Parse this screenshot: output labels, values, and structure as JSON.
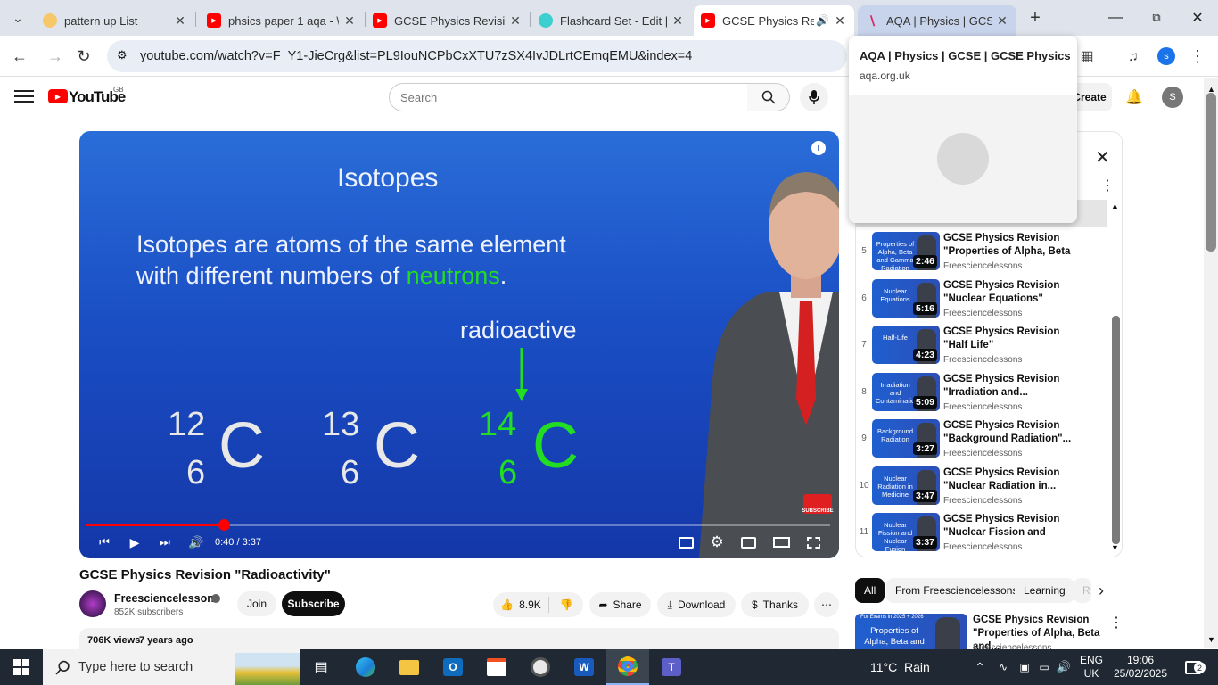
{
  "browser": {
    "tabs": [
      {
        "title": "pattern up List",
        "favicon": "lightbulb-icon"
      },
      {
        "title": "phsics paper 1 aqa - \\",
        "favicon": "youtube-icon"
      },
      {
        "title": "GCSE Physics Revisio",
        "favicon": "youtube-icon"
      },
      {
        "title": "Flashcard Set - Edit | ",
        "favicon": "quizlet-icon"
      },
      {
        "title": "GCSE Physics Rev",
        "favicon": "youtube-icon"
      },
      {
        "title": "AQA | Physics | GCSE",
        "favicon": "aqa-icon"
      }
    ],
    "url": "youtube.com/watch?v=F_Y1-JieCrg&list=PL9IouNCPbCxXTU7zSX4IvJDLrtCEmqEMU&index=4",
    "profile_initial": "s"
  },
  "hover_card": {
    "title": "AQA | Physics | GCSE | GCSE Physics",
    "domain": "aqa.org.uk"
  },
  "youtube": {
    "logo_text": "YouTube",
    "region": "GB",
    "search_placeholder": "Search",
    "create_label": "Create",
    "avatar_initial": "S"
  },
  "video": {
    "slide": {
      "heading": "Isotopes",
      "line1": "Isotopes are atoms of the same element",
      "line2_prefix": "with different numbers of ",
      "line2_highlight": "neutrons",
      "line2_suffix": ".",
      "label": "radioactive",
      "isotopes": [
        {
          "mass": "12",
          "atomic": "6",
          "symbol": "C"
        },
        {
          "mass": "13",
          "atomic": "6",
          "symbol": "C"
        },
        {
          "mass": "14",
          "atomic": "6",
          "symbol": "C"
        }
      ],
      "subscribe_badge": "SUBSCRIBE"
    },
    "time": "0:40 / 3:37",
    "progress": 0.185,
    "title": "GCSE Physics Revision \"Radioactivity\"",
    "channel": "Freesciencelessons",
    "subscribers": "852K subscribers",
    "join_label": "Join",
    "subscribe_label": "Subscribe",
    "likes": "8.9K",
    "share_label": "Share",
    "download_label": "Download",
    "thanks_label": "Thanks",
    "views": "706K views",
    "age": "7 years ago"
  },
  "playlist": [
    {
      "num": "5",
      "title": "GCSE Physics Revision \"Properties of Alpha, Beta a...",
      "channel": "Freesciencelessons",
      "duration": "2:46",
      "thumb_text": "Properties of Alpha, Beta and Gamma Radiation"
    },
    {
      "num": "6",
      "title": "GCSE Physics Revision \"Nuclear Equations\"",
      "channel": "Freesciencelessons",
      "duration": "5:16",
      "thumb_text": "Nuclear Equations"
    },
    {
      "num": "7",
      "title": "GCSE Physics Revision \"Half Life\"",
      "channel": "Freesciencelessons",
      "duration": "4:23",
      "thumb_text": "Half-Life"
    },
    {
      "num": "8",
      "title": "GCSE Physics Revision \"Irradiation and...",
      "channel": "Freesciencelessons",
      "duration": "5:09",
      "thumb_text": "Irradiation and Contamination"
    },
    {
      "num": "9",
      "title": "GCSE Physics Revision \"Background Radiation\"...",
      "channel": "Freesciencelessons",
      "duration": "3:27",
      "thumb_text": "Background Radiation"
    },
    {
      "num": "10",
      "title": "GCSE Physics Revision \"Nuclear Radiation in...",
      "channel": "Freesciencelessons",
      "duration": "3:47",
      "thumb_text": "Nuclear Radiation in Medicine"
    },
    {
      "num": "11",
      "title": "GCSE Physics Revision \"Nuclear Fission and Nuclea...",
      "channel": "Freesciencelessons",
      "duration": "3:37",
      "thumb_text": "Nuclear Fission and Nuclear Fusion"
    }
  ],
  "chips": [
    "All",
    "From Freesciencelessons",
    "Learning",
    "R"
  ],
  "recommended": {
    "title": "GCSE Physics Revision \"Properties of Alpha, Beta and...",
    "channel": "Freesciencelessons",
    "thumb_banner": "For Exams in 2025 + 2026",
    "thumb_text": "Properties of Alpha, Beta and"
  },
  "taskbar": {
    "search_placeholder": "Type here to search",
    "weather": "11°C  Rain",
    "lang1": "ENG",
    "lang2": "UK",
    "time": "19:06",
    "date": "25/02/2025",
    "notif_count": "2"
  }
}
